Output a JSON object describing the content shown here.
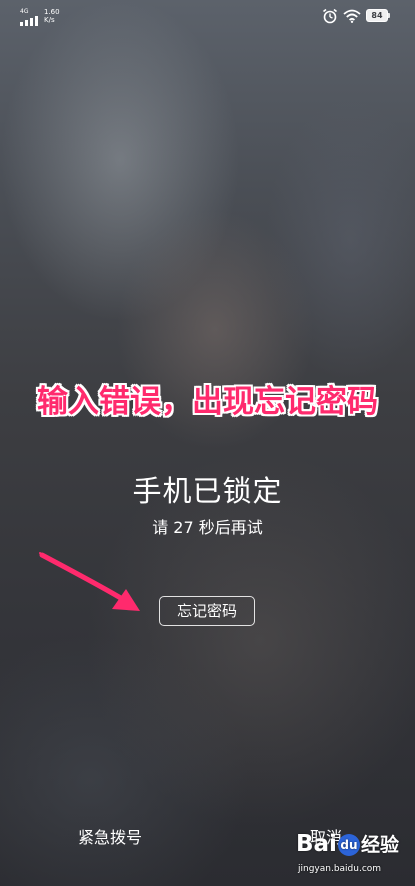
{
  "status_bar": {
    "network": "4G",
    "net_speed_value": "1.60",
    "net_speed_unit": "K/s",
    "battery": "84"
  },
  "annotation": "输入错误，出现忘记密码",
  "lock_screen": {
    "title": "手机已锁定",
    "retry_message": "请 27 秒后再试",
    "forgot_password_label": "忘记密码",
    "emergency_call_label": "紧急拨号",
    "cancel_label": "取消"
  },
  "watermark": {
    "logo_part1": "Bai",
    "logo_du": "du",
    "logo_part2": "经验",
    "url": "jingyan.baidu.com"
  },
  "colors": {
    "annotation": "#ff2a6d",
    "arrow": "#ff2a6d",
    "text": "#ffffff"
  }
}
